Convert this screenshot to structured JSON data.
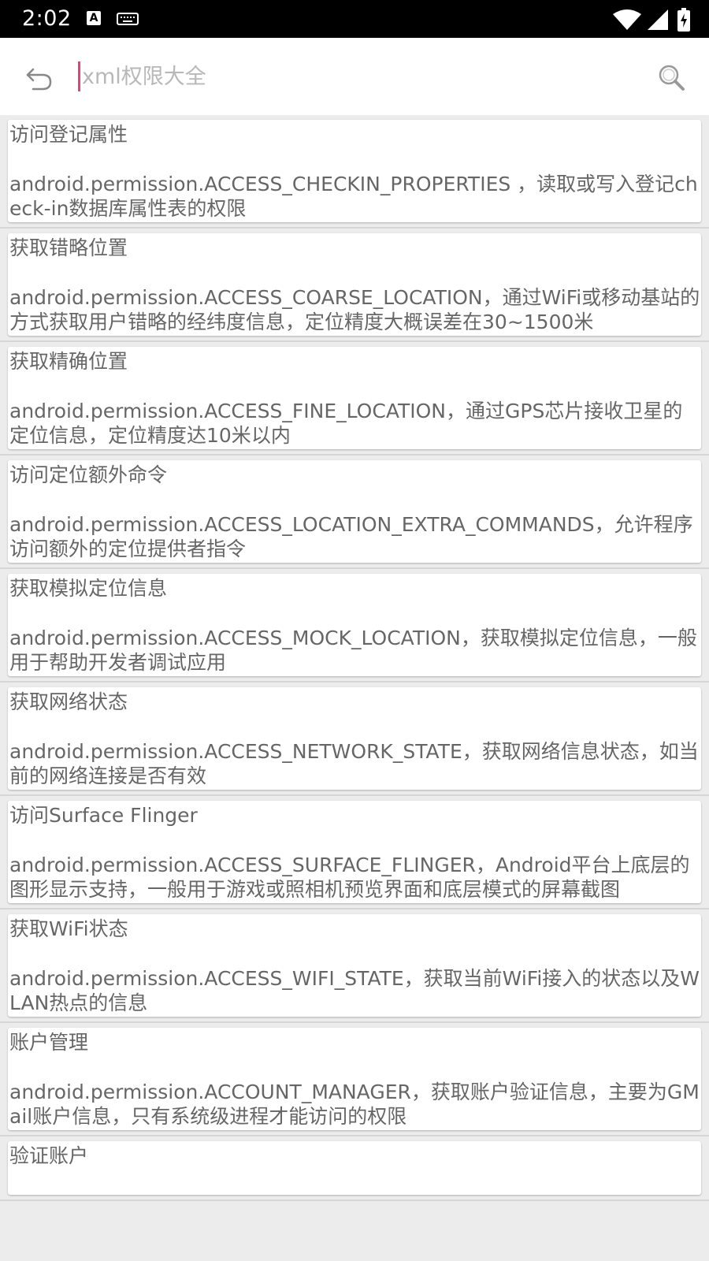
{
  "status_bar": {
    "time": "2:02",
    "a_badge": "A"
  },
  "search": {
    "placeholder": "xml权限大全",
    "value": ""
  },
  "permissions": [
    {
      "title": "访问登记属性",
      "desc": "android.permission.ACCESS_CHECKIN_PROPERTIES ，读取或写入登记check-in数据库属性表的权限"
    },
    {
      "title": "获取错略位置",
      "desc": "android.permission.ACCESS_COARSE_LOCATION，通过WiFi或移动基站的方式获取用户错略的经纬度信息，定位精度大概误差在30~1500米"
    },
    {
      "title": "获取精确位置",
      "desc": "android.permission.ACCESS_FINE_LOCATION，通过GPS芯片接收卫星的定位信息，定位精度达10米以内"
    },
    {
      "title": "访问定位额外命令",
      "desc": "android.permission.ACCESS_LOCATION_EXTRA_COMMANDS，允许程序访问额外的定位提供者指令"
    },
    {
      "title": "获取模拟定位信息",
      "desc": "android.permission.ACCESS_MOCK_LOCATION，获取模拟定位信息，一般用于帮助开发者调试应用"
    },
    {
      "title": "获取网络状态",
      "desc": "android.permission.ACCESS_NETWORK_STATE，获取网络信息状态，如当前的网络连接是否有效"
    },
    {
      "title": "访问Surface Flinger",
      "desc": "android.permission.ACCESS_SURFACE_FLINGER，Android平台上底层的图形显示支持，一般用于游戏或照相机预览界面和底层模式的屏幕截图"
    },
    {
      "title": "获取WiFi状态",
      "desc": "android.permission.ACCESS_WIFI_STATE，获取当前WiFi接入的状态以及WLAN热点的信息"
    },
    {
      "title": "账户管理",
      "desc": "android.permission.ACCOUNT_MANAGER，获取账户验证信息，主要为GMail账户信息，只有系统级进程才能访问的权限"
    },
    {
      "title": "验证账户",
      "desc": ""
    }
  ]
}
